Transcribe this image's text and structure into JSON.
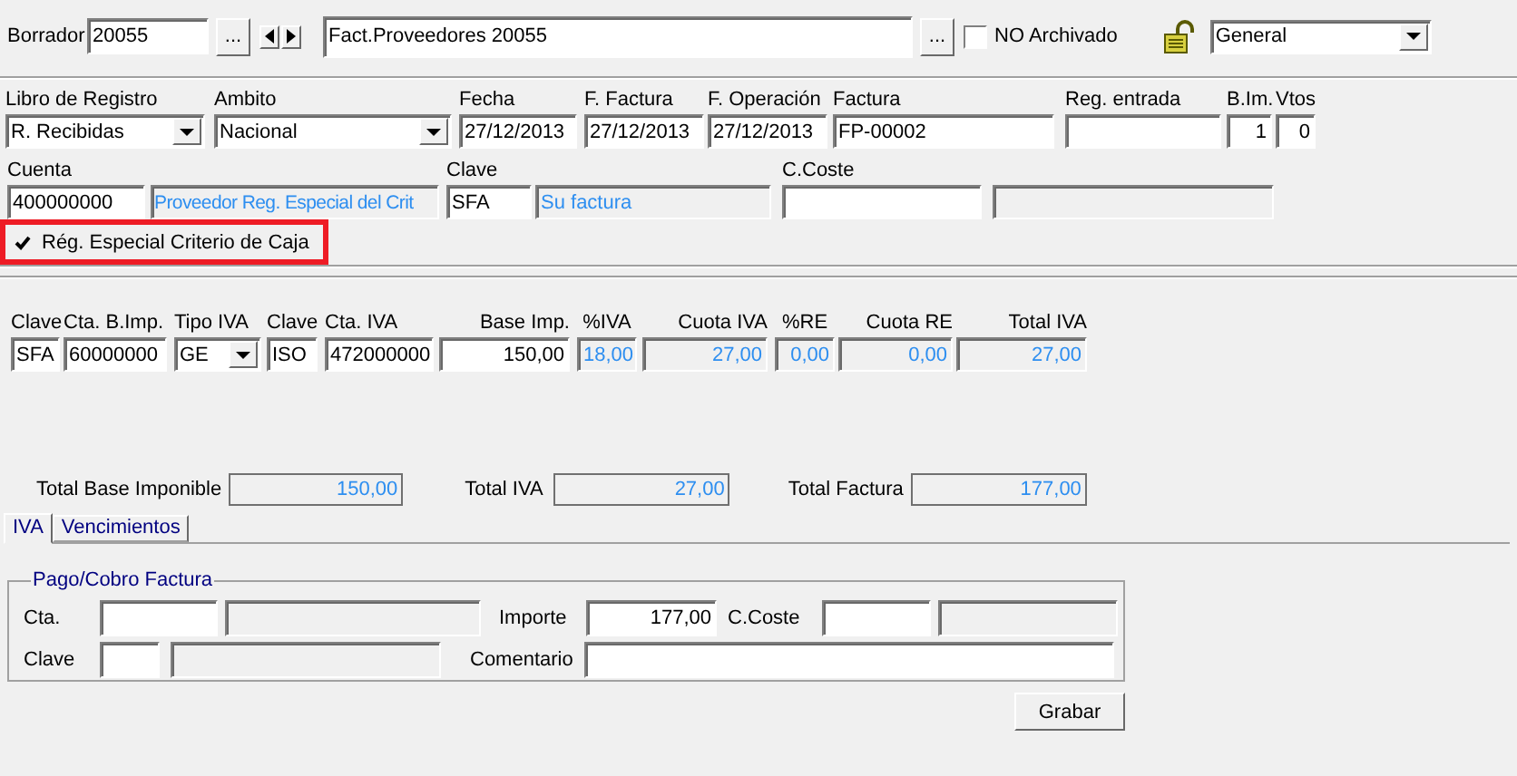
{
  "header": {
    "label": "Borrador",
    "number": "20055",
    "browse": "...",
    "description": "Fact.Proveedores 20055",
    "browse_2": "...",
    "no_archivado": {
      "label": "NO Archivado",
      "checked": false
    },
    "journal": "General"
  },
  "registro": [
    {
      "label": "Libro de Registro",
      "kind": "select",
      "value": "R. Recibidas"
    },
    {
      "label": "Ambito",
      "kind": "select",
      "value": "Nacional"
    },
    {
      "label": "Fecha",
      "kind": "input",
      "value": "27/12/2013"
    },
    {
      "label": "F. Factura",
      "kind": "input",
      "value": "27/12/2013"
    },
    {
      "label": "F. Operación",
      "kind": "input",
      "value": "27/12/2013"
    },
    {
      "label": "Factura",
      "kind": "input",
      "value": "FP-00002"
    },
    {
      "label": "Reg. entrada",
      "kind": "input"
    },
    {
      "label": "B.Im.",
      "kind": "input",
      "value": "1"
    },
    {
      "label": "Vtos",
      "kind": "input",
      "value": "0"
    }
  ],
  "cuenta": [
    {
      "label": "Cuenta",
      "kind": "input",
      "value": "400000000"
    },
    {
      "kind": "readonly",
      "value": "Proveedor Reg. Especial del Crit"
    },
    {
      "label": "Clave",
      "kind": "input",
      "value": "SFA"
    },
    {
      "kind": "readonly",
      "value": "Su factura"
    },
    {
      "label": "C.Coste",
      "kind": "input"
    },
    {
      "kind": "readonly"
    }
  ],
  "criterio_caja": {
    "label": "Rég. Especial Criterio de Caja",
    "checked": true,
    "highlighted": true
  },
  "iva_line": [
    {
      "label": "Clave",
      "kind": "input",
      "value": "SFA"
    },
    {
      "label": "Cta. B.Imp.",
      "kind": "input",
      "value": "60000000"
    },
    {
      "label": "Tipo IVA",
      "kind": "select",
      "value": "GE"
    },
    {
      "label": "Clave",
      "kind": "input",
      "value": "ISO"
    },
    {
      "label": "Cta. IVA",
      "kind": "input",
      "value": "472000000"
    },
    {
      "label": "Base Imp.",
      "kind": "input",
      "value": "150,00"
    },
    {
      "label": "%IVA",
      "kind": "readonly",
      "value": "18,00"
    },
    {
      "label": "Cuota IVA",
      "kind": "readonly",
      "value": "27,00"
    },
    {
      "label": "%RE",
      "kind": "readonly",
      "value": "0,00"
    },
    {
      "label": "Cuota RE",
      "kind": "readonly",
      "value": "0,00"
    },
    {
      "label": "Total IVA",
      "kind": "readonly",
      "value": "27,00"
    }
  ],
  "totals": [
    {
      "label": "Total Base Imponible",
      "value": "150,00"
    },
    {
      "label": "Total IVA",
      "value": "27,00"
    },
    {
      "label": "Total Factura",
      "value": "177,00"
    }
  ],
  "tabs": [
    {
      "label": "IVA",
      "selected": true
    },
    {
      "label": "Vencimientos",
      "selected": false
    }
  ],
  "payment": {
    "title": "Pago/Cobro Factura",
    "rows": [
      [
        {
          "kind": "label",
          "value": "Cta."
        },
        {
          "kind": "input"
        },
        {
          "kind": "readonly"
        },
        {
          "kind": "label",
          "value": "Importe"
        },
        {
          "kind": "input",
          "value": "177,00"
        },
        {
          "kind": "label",
          "value": "C.Coste"
        },
        {
          "kind": "input"
        },
        {
          "kind": "readonly"
        }
      ],
      [
        {
          "kind": "label",
          "value": "Clave"
        },
        {
          "kind": "input"
        },
        {
          "kind": "readonly"
        },
        {
          "kind": "label",
          "value": "Comentario"
        },
        {
          "kind": "input"
        }
      ]
    ]
  },
  "save_button": "Grabar"
}
